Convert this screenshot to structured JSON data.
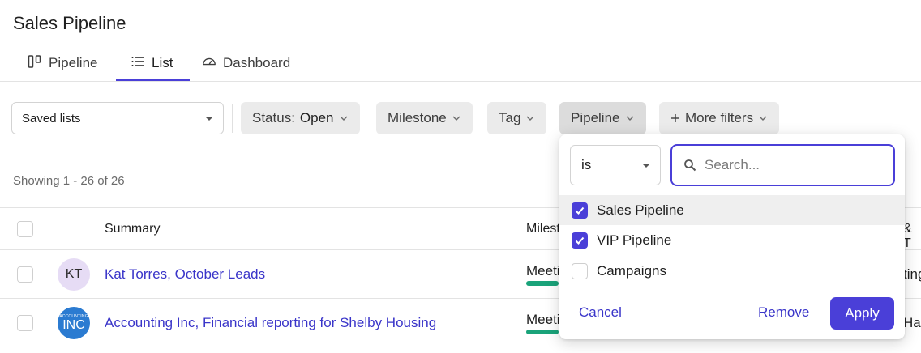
{
  "header": {
    "title": "Sales Pipeline"
  },
  "tabs": [
    {
      "label": "Pipeline",
      "icon": "pipeline-board-icon",
      "active": false
    },
    {
      "label": "List",
      "icon": "list-icon",
      "active": true
    },
    {
      "label": "Dashboard",
      "icon": "dashboard-gauge-icon",
      "active": false
    }
  ],
  "filters": {
    "saved_lists": "Saved lists",
    "status_label": "Status:",
    "status_value": "Open",
    "milestone": "Milestone",
    "tag": "Tag",
    "pipeline": "Pipeline",
    "more_filters": "More filters"
  },
  "showing": "Showing 1 - 26 of 26",
  "table": {
    "columns": {
      "summary": "Summary",
      "milestone": "Milest",
      "last": "& T"
    },
    "rows": [
      {
        "avatar": "KT",
        "summary": "Kat Torres, October Leads",
        "milestone": "Meeti",
        "last": "ting"
      },
      {
        "avatar_small": "ACCOUNTING",
        "avatar_big": "INC",
        "summary": "Accounting Inc, Financial reporting for Shelby Housing",
        "milestone": "Meeti",
        "last": "Hai"
      }
    ]
  },
  "popover": {
    "operator": "is",
    "search_placeholder": "Search...",
    "search_value": "",
    "options": [
      {
        "label": "Sales Pipeline",
        "checked": true
      },
      {
        "label": "VIP Pipeline",
        "checked": true
      },
      {
        "label": "Campaigns",
        "checked": false
      }
    ],
    "cancel": "Cancel",
    "remove": "Remove",
    "apply": "Apply"
  },
  "colors": {
    "accent": "#4a3fd8",
    "link": "#3a35c9",
    "milestone_bar": "#1aa37a"
  }
}
